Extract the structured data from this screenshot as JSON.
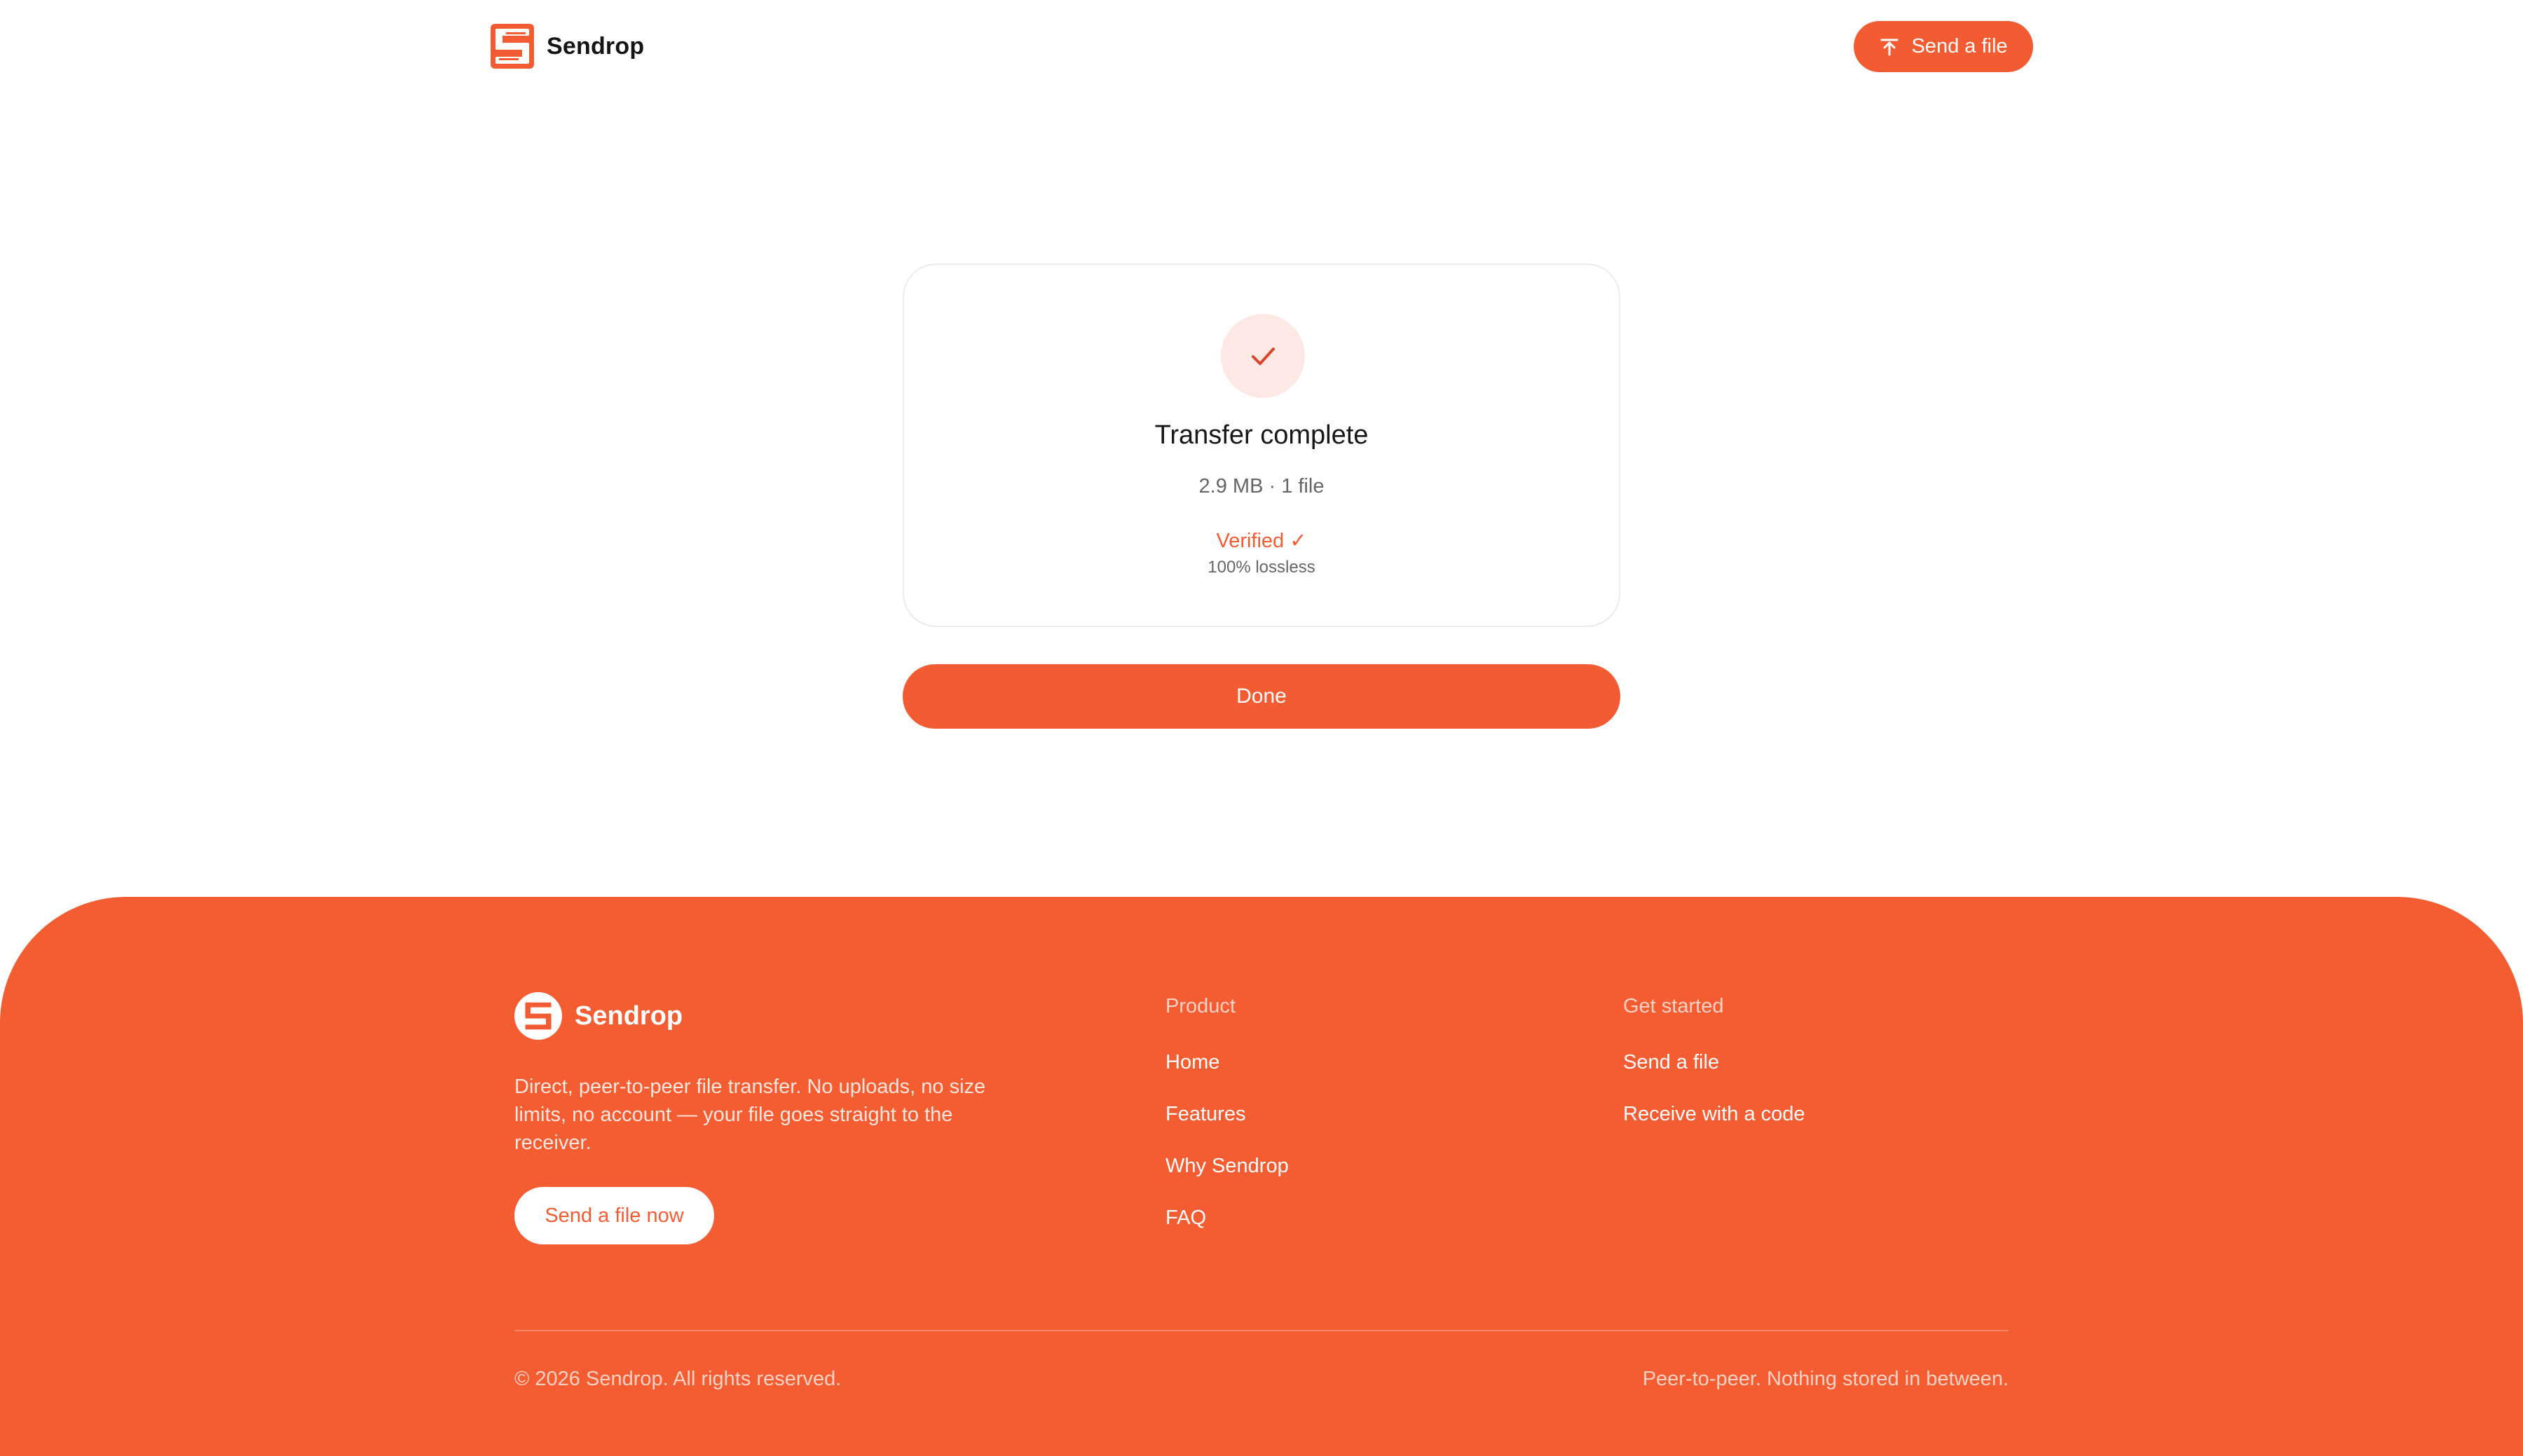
{
  "header": {
    "brand_name": "Sendrop",
    "cta_label": "Send a file"
  },
  "card": {
    "title": "Transfer complete",
    "meta": "2.9 MB · 1 file",
    "verified": "Verified ✓",
    "lossless": "100% lossless"
  },
  "done_label": "Done",
  "footer": {
    "brand_name": "Sendrop",
    "description": "Direct, peer-to-peer file transfer. No uploads, no size limits, no account — your file goes straight to the receiver.",
    "cta_label": "Send a file now",
    "product": {
      "title": "Product",
      "links": [
        "Home",
        "Features",
        "Why Sendrop",
        "FAQ"
      ]
    },
    "get_started": {
      "title": "Get started",
      "links": [
        "Send a file",
        "Receive with a code"
      ]
    },
    "copyright": "© 2026 Sendrop. All rights reserved.",
    "tagline": "Peer-to-peer. Nothing stored in between."
  },
  "colors": {
    "accent": "#f35c32",
    "accent_soft": "#fde9e3"
  },
  "icons": {
    "brand": "sendrop-logo-icon",
    "header_cta": "send-icon",
    "status": "checkmark-icon"
  }
}
